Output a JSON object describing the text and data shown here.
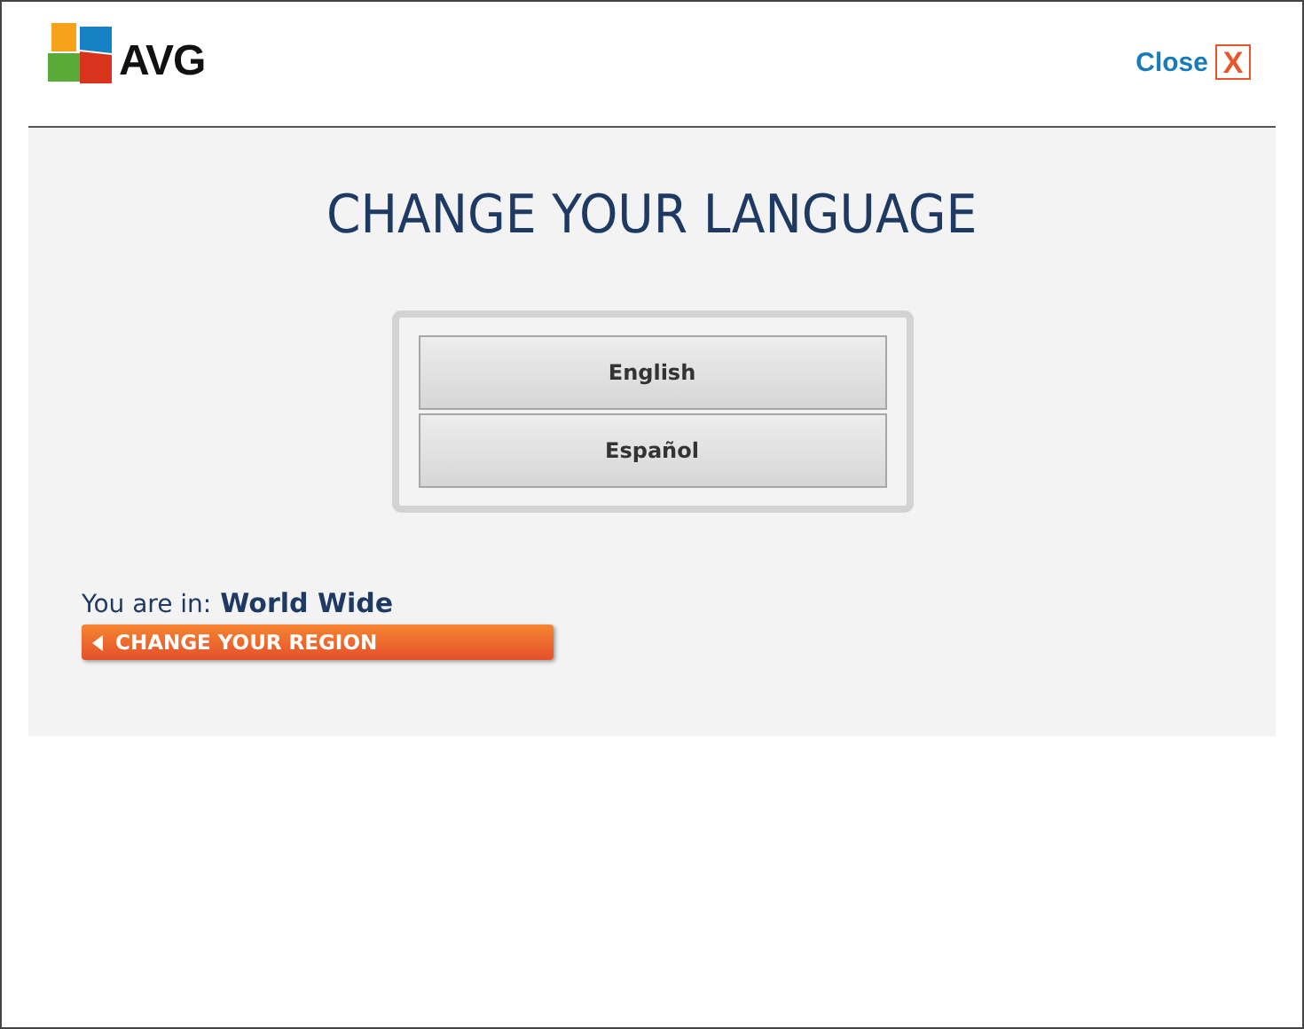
{
  "header": {
    "logo": "AVG",
    "close_label": "Close",
    "close_glyph": "X"
  },
  "title": "CHANGE YOUR LANGUAGE",
  "languages": [
    {
      "label": "English"
    },
    {
      "label": "Español"
    }
  ],
  "region": {
    "prefix": "You are in:",
    "name": "World Wide",
    "button": "CHANGE YOUR REGION"
  }
}
